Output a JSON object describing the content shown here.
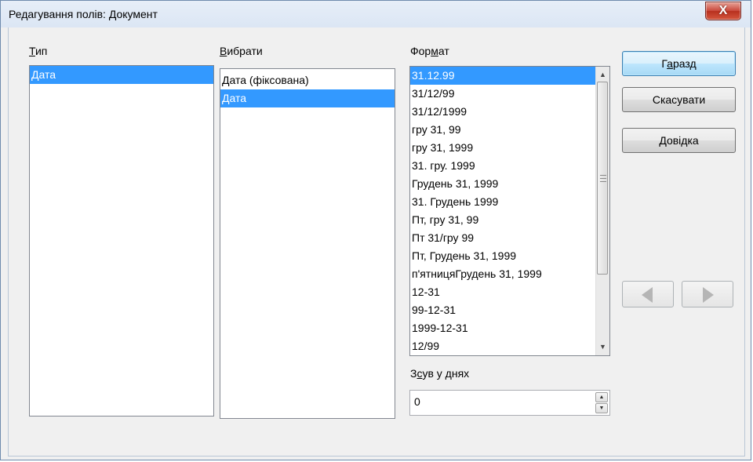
{
  "window": {
    "title": "Редагування полів: Документ",
    "close_glyph": "X"
  },
  "type_list": {
    "label_underline": "Т",
    "label_rest": "ип",
    "items": [
      {
        "label": "Дата",
        "selected": true
      }
    ]
  },
  "select_list": {
    "label_underline": "В",
    "label_rest": "ибрати",
    "items": [
      {
        "label": "Дата (фіксована)",
        "selected": false
      },
      {
        "label": "Дата",
        "selected": true
      }
    ]
  },
  "format_list": {
    "label_pre": "Фор",
    "label_underline": "м",
    "label_rest": "ат",
    "items": [
      {
        "label": "31.12.99",
        "selected": true
      },
      {
        "label": "31/12/99",
        "selected": false
      },
      {
        "label": "31/12/1999",
        "selected": false
      },
      {
        "label": "гру 31, 99",
        "selected": false
      },
      {
        "label": "гру 31, 1999",
        "selected": false
      },
      {
        "label": "31. гру. 1999",
        "selected": false
      },
      {
        "label": "Грудень 31, 1999",
        "selected": false
      },
      {
        "label": "31. Грудень 1999",
        "selected": false
      },
      {
        "label": "Пт, гру 31, 99",
        "selected": false
      },
      {
        "label": "Пт 31/гру 99",
        "selected": false
      },
      {
        "label": "Пт, Грудень 31, 1999",
        "selected": false
      },
      {
        "label": "п'ятницяГрудень 31, 1999",
        "selected": false
      },
      {
        "label": "12-31",
        "selected": false
      },
      {
        "label": "99-12-31",
        "selected": false
      },
      {
        "label": "1999-12-31",
        "selected": false
      },
      {
        "label": "12/99",
        "selected": false
      }
    ]
  },
  "offset": {
    "label_pre": "З",
    "label_underline": "с",
    "label_rest": "ув у днях",
    "value": "0"
  },
  "buttons": {
    "ok_pre": "Г",
    "ok_underline": "а",
    "ok_rest": "разд",
    "cancel": "Скасувати",
    "help_underline": "Д",
    "help_rest": "овідка"
  },
  "icons": {
    "close": "close-icon",
    "prev": "arrow-left-icon",
    "next": "arrow-right-icon",
    "scroll_up": "scroll-up-icon",
    "scroll_down": "scroll-down-icon",
    "spin_up": "spin-up-icon",
    "spin_down": "spin-down-icon"
  },
  "colors": {
    "selection": "#3399ff",
    "dialog_bg": "#f0f0f0",
    "close_button": "#c9473a"
  }
}
